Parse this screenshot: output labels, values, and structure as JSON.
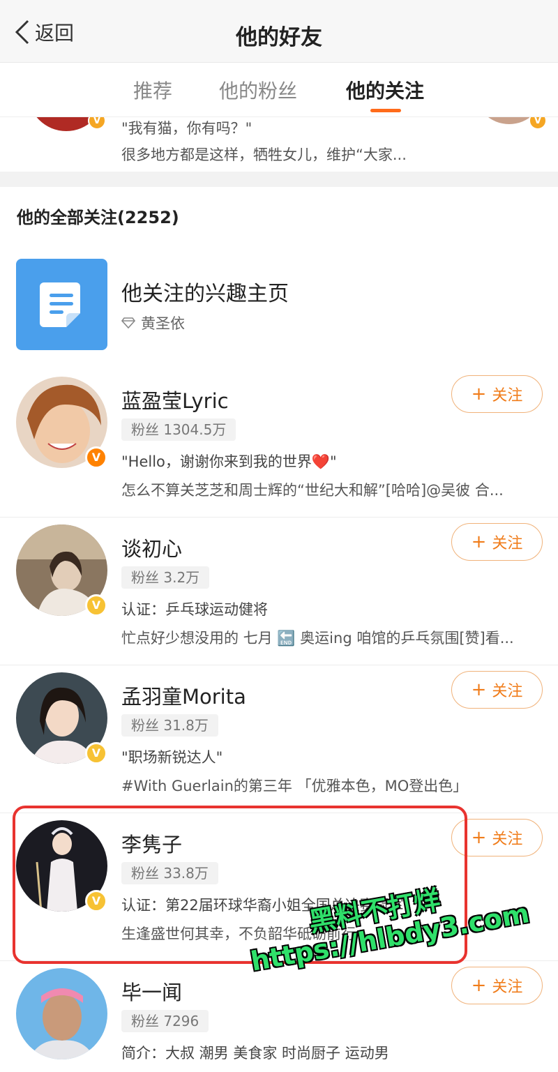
{
  "nav": {
    "back_label": "返回",
    "title": "他的好友"
  },
  "tabs": [
    {
      "label": "推荐",
      "active": false
    },
    {
      "label": "他的粉丝",
      "active": false
    },
    {
      "label": "他的关注",
      "active": true
    }
  ],
  "top_partial": {
    "line1": "\"我有猫，你有吗？\"",
    "line2": "很多地方都是这样，牺牲女儿，维护“大家..."
  },
  "section_title": "他的全部关注(2252)",
  "interest": {
    "title": "他关注的兴趣主页",
    "subtitle": "黄圣依"
  },
  "follow_label": "关注",
  "users": [
    {
      "name": "蓝盈莹Lyric",
      "fans": "粉丝 1304.5万",
      "desc1": "\"Hello，谢谢你来到我的世界❤️\"",
      "desc2": "怎么不算关芝芝和周士辉的“世纪大和解”[哈哈]@吴彼 合...",
      "badge": "red"
    },
    {
      "name": "谈初心",
      "fans": "粉丝 3.2万",
      "desc1": "认证：乒乓球运动健将",
      "desc2": "忙点好少想没用的 七月 🔚 奥运ing 咱馆的乒乓氛围[赞]看...",
      "badge": "gold"
    },
    {
      "name": "孟羽童Morita",
      "fans": "粉丝 31.8万",
      "desc1": "\"职场新锐达人\"",
      "desc2": "#With Guerlain的第三年 「优雅本色，MO登出色」",
      "badge": "gold"
    },
    {
      "name": "李隽子",
      "fans": "粉丝 33.8万",
      "desc1": "认证：第22届环球华裔小姐全国总决赛冠军",
      "desc2": "生逢盛世何其幸，不负韶华砥砺前行",
      "badge": "gold"
    },
    {
      "name": "毕一闻",
      "fans": "粉丝 7296",
      "desc1": "简介：大叔 潮男 美食家 时尚厨子 运动男",
      "desc2": "",
      "badge": "none"
    }
  ],
  "watermark": {
    "line1": "黑料不打烊",
    "line2": "https://hlbdy3.com"
  },
  "colors": {
    "accent": "#ff6b1a",
    "follow": "#f07c1a",
    "highlight": "#e8332f",
    "watermark": "#2fe06a",
    "interest_icon": "#4a9fec"
  }
}
